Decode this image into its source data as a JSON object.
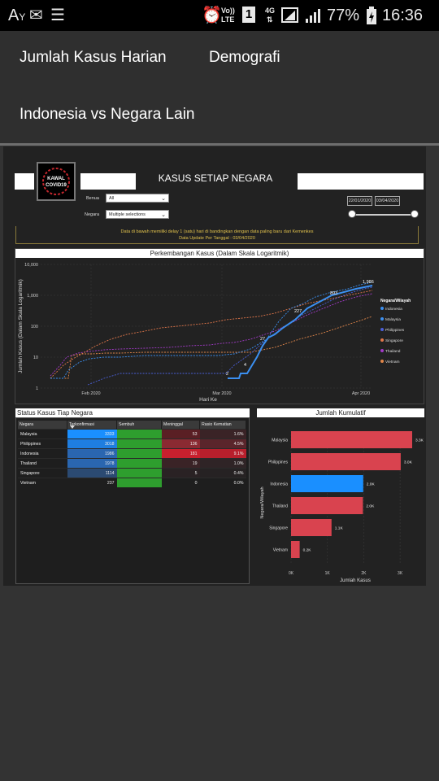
{
  "status": {
    "left_icons": [
      "font-icon",
      "mail-icon",
      "list-icon"
    ],
    "alarm": "alarm-icon",
    "volte_top": "Vo))",
    "volte_bottom": "LTE",
    "sim": "1",
    "net_top": "4G",
    "net_bottom": "⇅",
    "battery": "77%",
    "time": "16:36"
  },
  "nav": {
    "item1": "Jumlah Kasus Harian",
    "item2": "Demografi",
    "item3": "Indonesia vs Negara Lain"
  },
  "report": {
    "title": "KASUS SETIAP NEGARA",
    "logo_line1": "KAWAL",
    "logo_line2": "COVID19",
    "filter_benua_label": "Benua",
    "filter_benua_value": "All",
    "filter_negara_label": "Negara",
    "filter_negara_value": "Multiple selections",
    "date_from": "22/01/2020",
    "date_to": "03/04/2020",
    "notice_line1": "Data di bawah memiliki delay 1 (satu) hari di bandingkan dengan data paling baru dari Kemenkes",
    "notice_line2": "Data Update Per Tanggal :",
    "notice_date": "03/04/2020"
  },
  "chart_data": [
    {
      "type": "line",
      "title": "Perkembangan Kasus (Dalam Skala Logaritmik)",
      "xlabel": "Hari Ke",
      "ylabel": "Jumlah Kasus (Dalam Skala Logaritmik)",
      "yscale": "log",
      "yticks": [
        "1",
        "10",
        "100",
        "1,000",
        "10,000"
      ],
      "xticks": [
        "Feb 2020",
        "Mar 2020",
        "Apr 2020"
      ],
      "legend_title": "Negara/Wilayah",
      "legend_position": "right",
      "data_labels": [
        "2",
        "4",
        "27",
        "227",
        "893",
        "1,986"
      ],
      "series": [
        {
          "name": "Indonesia",
          "color": "#3b8ff0",
          "style": "solid"
        },
        {
          "name": "Malaysia",
          "color": "#3b8ff0",
          "style": "dashed"
        },
        {
          "name": "Philippines",
          "color": "#4a5fd6",
          "style": "dashed"
        },
        {
          "name": "Singapore",
          "color": "#e0764a",
          "style": "dashed"
        },
        {
          "name": "Thailand",
          "color": "#a23ac8",
          "style": "dashed"
        },
        {
          "name": "Vietnam",
          "color": "#e0864a",
          "style": "dashed"
        }
      ]
    },
    {
      "type": "bar",
      "orientation": "horizontal",
      "title": "Jumlah Kumulatif",
      "xlabel": "Jumlah Kasus",
      "ylabel": "Negara/Wilayah",
      "xticks": [
        "0K",
        "1K",
        "2K",
        "3K"
      ],
      "xlim": [
        0,
        3400
      ],
      "categories": [
        "Malaysia",
        "Philippines",
        "Indonesia",
        "Thailand",
        "Singapore",
        "Vietnam"
      ],
      "values": [
        3333,
        3018,
        1986,
        1978,
        1114,
        237
      ],
      "labels": [
        "3.3K",
        "3.0K",
        "2.0K",
        "2.0K",
        "1.1K",
        "0.2K"
      ],
      "colors": [
        "#d9434f",
        "#d9434f",
        "#1a8fff",
        "#d9434f",
        "#d9434f",
        "#d9434f"
      ]
    }
  ],
  "table": {
    "title": "Status Kasus Tiap Negara",
    "headers": [
      "Negara",
      "Terkonfirmasi",
      "Sembuh",
      "Meninggal",
      "Rasio Kematian"
    ],
    "rows": [
      [
        "Malaysia",
        "3333",
        "",
        "53",
        "1.6%"
      ],
      [
        "Philippines",
        "3018",
        "",
        "136",
        "4.5%"
      ],
      [
        "Indonesia",
        "1986",
        "",
        "181",
        "9.1%"
      ],
      [
        "Thailand",
        "1978",
        "",
        "19",
        "1.0%"
      ],
      [
        "Singapore",
        "1114",
        "",
        "5",
        "0.4%"
      ],
      [
        "Vietnam",
        "237",
        "",
        "0",
        "0.0%"
      ]
    ]
  }
}
